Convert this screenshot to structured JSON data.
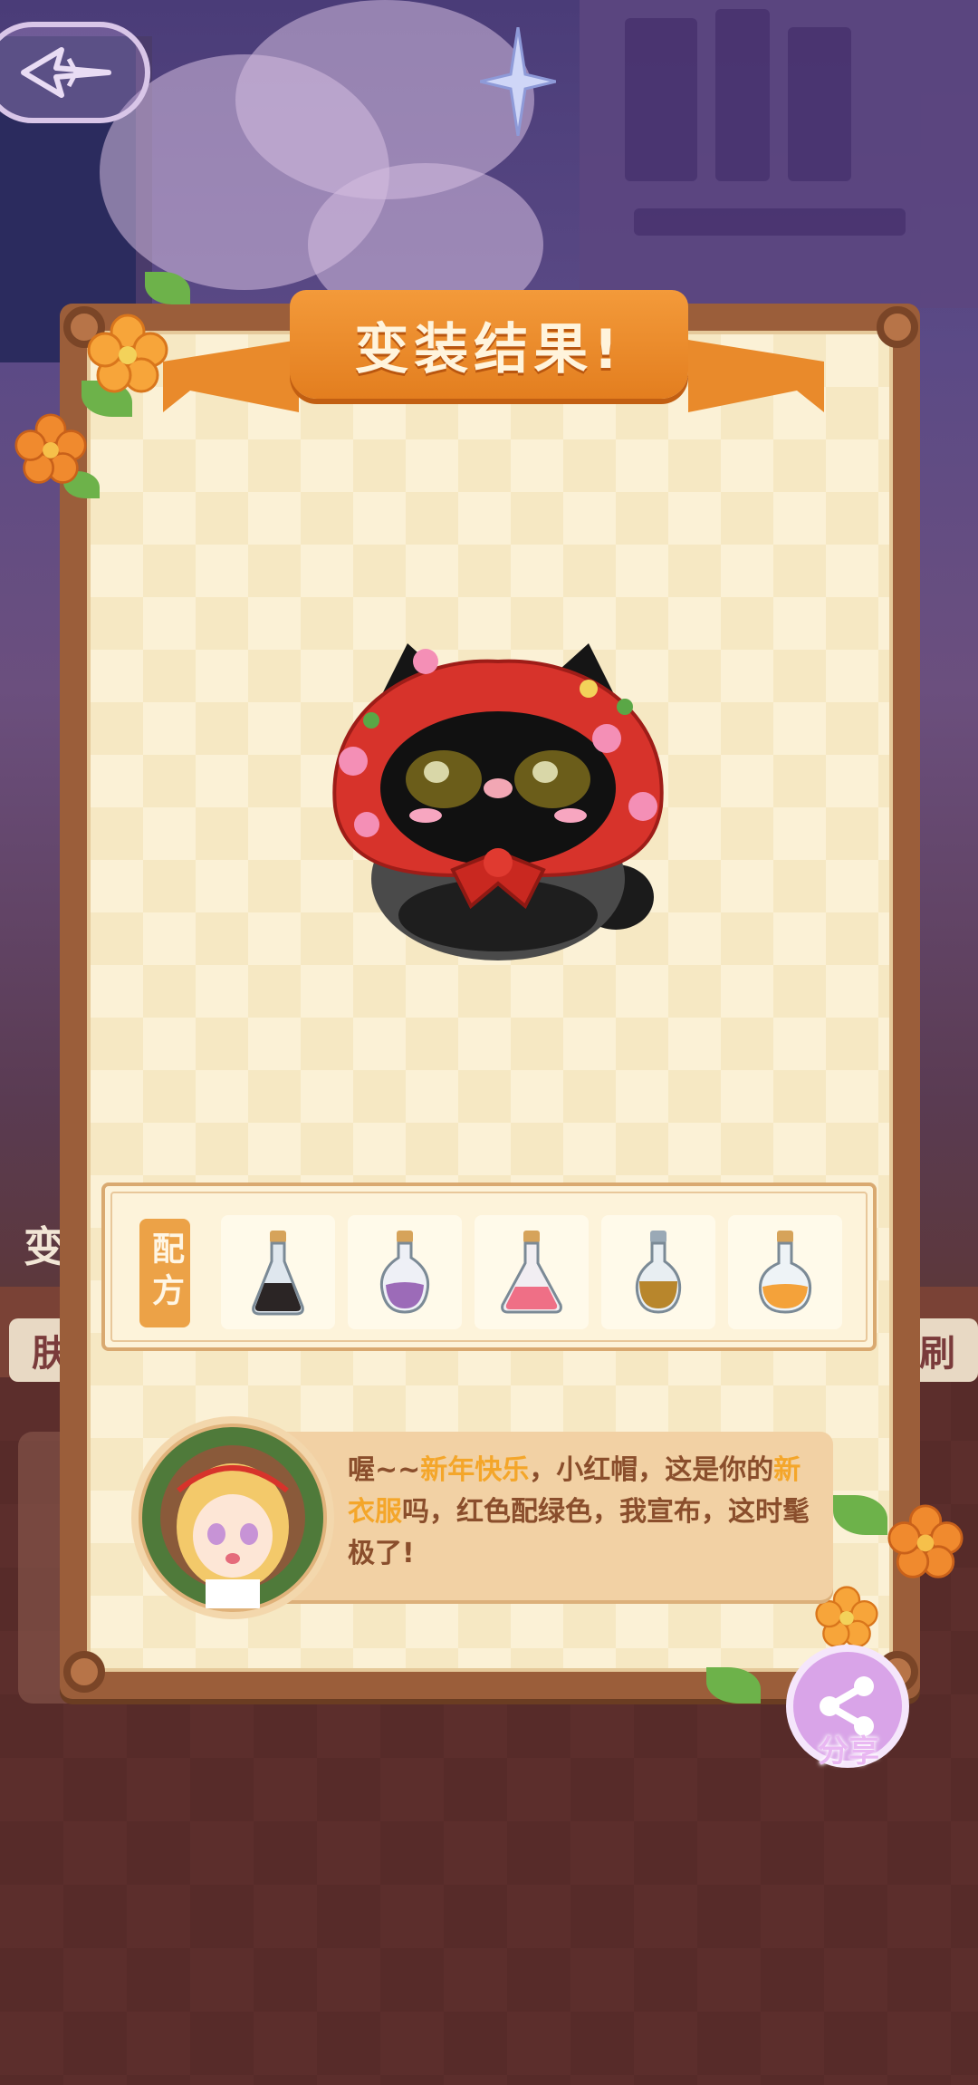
{
  "title": "变装结果!",
  "recipe": {
    "label": "配方",
    "potions": [
      {
        "icon": "black-potion-icon",
        "color": "#2b2525"
      },
      {
        "icon": "purple-potion-icon",
        "color": "#9c6bb8"
      },
      {
        "icon": "pink-potion-icon",
        "color": "#ef6f86"
      },
      {
        "icon": "amber-potion-icon",
        "color": "#b8862c"
      },
      {
        "icon": "orange-potion-icon",
        "color": "#f4a23a"
      }
    ]
  },
  "dialogue": {
    "part1": "喔~~",
    "highlight1": "新年快乐",
    "part2": "，小红帽，这是你的",
    "highlight2": "新衣服",
    "part3": "吗，红色配绿色，我宣布，这时髦极了!"
  },
  "share_label": "分享",
  "background": {
    "side_left_text": "变",
    "side_tag_left": "肤",
    "side_tag_right": "刷"
  },
  "colors": {
    "ribbon": "#e98a2b",
    "frame": "#9b5e3a",
    "panel": "#fbf1d6",
    "highlight_text": "#f4a62a",
    "dialog_text": "#8a4e2c"
  }
}
